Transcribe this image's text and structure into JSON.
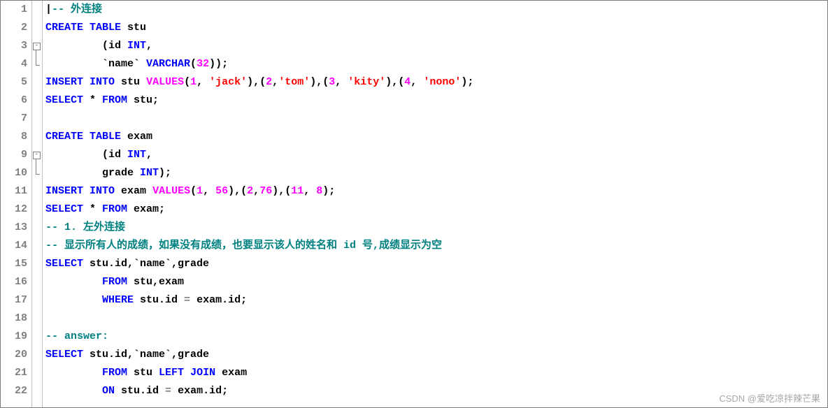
{
  "watermark": "CSDN @爱吃凉拌辣芒果",
  "line_count": 22,
  "fold_regions": [
    {
      "start": 3,
      "end": 4
    },
    {
      "start": 9,
      "end": 10
    }
  ],
  "code_lines": [
    {
      "n": 1,
      "tokens": [
        {
          "t": "|",
          "c": "hl-black"
        },
        {
          "t": "-- 外连接",
          "c": "hl-active"
        }
      ],
      "cursor_before": 0
    },
    {
      "n": 2,
      "tokens": [
        {
          "t": "CREATE",
          "c": "hl-keyword"
        },
        {
          "t": " ",
          "c": ""
        },
        {
          "t": "TABLE",
          "c": "hl-keyword"
        },
        {
          "t": " stu",
          "c": "hl-black"
        }
      ]
    },
    {
      "n": 3,
      "tokens": [
        {
          "t": "         (id ",
          "c": "hl-black"
        },
        {
          "t": "INT",
          "c": "hl-keyword"
        },
        {
          "t": ",",
          "c": "hl-black"
        }
      ]
    },
    {
      "n": 4,
      "tokens": [
        {
          "t": "         `name` ",
          "c": "hl-black"
        },
        {
          "t": "VARCHAR",
          "c": "hl-keyword"
        },
        {
          "t": "(",
          "c": "hl-black"
        },
        {
          "t": "32",
          "c": "hl-func"
        },
        {
          "t": "));",
          "c": "hl-black"
        }
      ]
    },
    {
      "n": 5,
      "tokens": [
        {
          "t": "INSERT",
          "c": "hl-keyword"
        },
        {
          "t": " ",
          "c": ""
        },
        {
          "t": "INTO",
          "c": "hl-keyword"
        },
        {
          "t": " stu ",
          "c": "hl-black"
        },
        {
          "t": "VALUES",
          "c": "hl-func"
        },
        {
          "t": "(",
          "c": "hl-black"
        },
        {
          "t": "1",
          "c": "hl-func"
        },
        {
          "t": ", ",
          "c": "hl-black"
        },
        {
          "t": "'jack'",
          "c": "hl-string"
        },
        {
          "t": "),(",
          "c": "hl-black"
        },
        {
          "t": "2",
          "c": "hl-func"
        },
        {
          "t": ",",
          "c": "hl-black"
        },
        {
          "t": "'tom'",
          "c": "hl-string"
        },
        {
          "t": "),(",
          "c": "hl-black"
        },
        {
          "t": "3",
          "c": "hl-func"
        },
        {
          "t": ", ",
          "c": "hl-black"
        },
        {
          "t": "'kity'",
          "c": "hl-string"
        },
        {
          "t": "),(",
          "c": "hl-black"
        },
        {
          "t": "4",
          "c": "hl-func"
        },
        {
          "t": ", ",
          "c": "hl-black"
        },
        {
          "t": "'nono'",
          "c": "hl-string"
        },
        {
          "t": ");",
          "c": "hl-black"
        }
      ]
    },
    {
      "n": 6,
      "tokens": [
        {
          "t": "SELECT",
          "c": "hl-keyword"
        },
        {
          "t": " * ",
          "c": "hl-black"
        },
        {
          "t": "FROM",
          "c": "hl-keyword"
        },
        {
          "t": " stu;",
          "c": "hl-black"
        }
      ]
    },
    {
      "n": 7,
      "tokens": [
        {
          "t": "",
          "c": ""
        }
      ]
    },
    {
      "n": 8,
      "tokens": [
        {
          "t": "CREATE",
          "c": "hl-keyword"
        },
        {
          "t": " ",
          "c": ""
        },
        {
          "t": "TABLE",
          "c": "hl-keyword"
        },
        {
          "t": " exam",
          "c": "hl-black"
        }
      ]
    },
    {
      "n": 9,
      "tokens": [
        {
          "t": "         (id ",
          "c": "hl-black"
        },
        {
          "t": "INT",
          "c": "hl-keyword"
        },
        {
          "t": ",",
          "c": "hl-black"
        }
      ]
    },
    {
      "n": 10,
      "tokens": [
        {
          "t": "         grade ",
          "c": "hl-black"
        },
        {
          "t": "INT",
          "c": "hl-keyword"
        },
        {
          "t": ");",
          "c": "hl-black"
        }
      ]
    },
    {
      "n": 11,
      "tokens": [
        {
          "t": "INSERT",
          "c": "hl-keyword"
        },
        {
          "t": " ",
          "c": ""
        },
        {
          "t": "INTO",
          "c": "hl-keyword"
        },
        {
          "t": " exam ",
          "c": "hl-black"
        },
        {
          "t": "VALUES",
          "c": "hl-func"
        },
        {
          "t": "(",
          "c": "hl-black"
        },
        {
          "t": "1",
          "c": "hl-func"
        },
        {
          "t": ", ",
          "c": "hl-black"
        },
        {
          "t": "56",
          "c": "hl-func"
        },
        {
          "t": "),(",
          "c": "hl-black"
        },
        {
          "t": "2",
          "c": "hl-func"
        },
        {
          "t": ",",
          "c": "hl-black"
        },
        {
          "t": "76",
          "c": "hl-func"
        },
        {
          "t": "),(",
          "c": "hl-black"
        },
        {
          "t": "11",
          "c": "hl-func"
        },
        {
          "t": ", ",
          "c": "hl-black"
        },
        {
          "t": "8",
          "c": "hl-func"
        },
        {
          "t": ");",
          "c": "hl-black"
        }
      ]
    },
    {
      "n": 12,
      "tokens": [
        {
          "t": "SELECT",
          "c": "hl-keyword"
        },
        {
          "t": " * ",
          "c": "hl-black"
        },
        {
          "t": "FROM",
          "c": "hl-keyword"
        },
        {
          "t": " exam;",
          "c": "hl-black"
        }
      ]
    },
    {
      "n": 13,
      "tokens": [
        {
          "t": "-- 1. 左外连接",
          "c": "hl-comment"
        }
      ]
    },
    {
      "n": 14,
      "tokens": [
        {
          "t": "-- 显示所有人的成绩，如果没有成绩，也要显示该人的姓名和 id 号,成绩显示为空",
          "c": "hl-comment"
        }
      ]
    },
    {
      "n": 15,
      "tokens": [
        {
          "t": "SELECT",
          "c": "hl-keyword"
        },
        {
          "t": " stu.id,`name`,grade",
          "c": "hl-black"
        }
      ]
    },
    {
      "n": 16,
      "tokens": [
        {
          "t": "         ",
          "c": ""
        },
        {
          "t": "FROM",
          "c": "hl-keyword"
        },
        {
          "t": " stu,exam",
          "c": "hl-black"
        }
      ]
    },
    {
      "n": 17,
      "tokens": [
        {
          "t": "         ",
          "c": ""
        },
        {
          "t": "WHERE",
          "c": "hl-keyword"
        },
        {
          "t": " stu.id ",
          "c": "hl-black"
        },
        {
          "t": "=",
          "c": "hl-gray"
        },
        {
          "t": " exam.id;",
          "c": "hl-black"
        }
      ]
    },
    {
      "n": 18,
      "tokens": [
        {
          "t": "",
          "c": ""
        }
      ]
    },
    {
      "n": 19,
      "tokens": [
        {
          "t": "-- answer:",
          "c": "hl-comment"
        }
      ]
    },
    {
      "n": 20,
      "tokens": [
        {
          "t": "SELECT",
          "c": "hl-keyword"
        },
        {
          "t": " stu.id,`name`,grade",
          "c": "hl-black"
        }
      ]
    },
    {
      "n": 21,
      "tokens": [
        {
          "t": "         ",
          "c": ""
        },
        {
          "t": "FROM",
          "c": "hl-keyword"
        },
        {
          "t": " stu ",
          "c": "hl-black"
        },
        {
          "t": "LEFT",
          "c": "hl-keyword"
        },
        {
          "t": " ",
          "c": ""
        },
        {
          "t": "JOIN",
          "c": "hl-keyword"
        },
        {
          "t": " exam",
          "c": "hl-black"
        }
      ]
    },
    {
      "n": 22,
      "tokens": [
        {
          "t": "         ",
          "c": ""
        },
        {
          "t": "ON",
          "c": "hl-keyword"
        },
        {
          "t": " stu.id ",
          "c": "hl-black"
        },
        {
          "t": "=",
          "c": "hl-gray"
        },
        {
          "t": " exam.id;",
          "c": "hl-black"
        }
      ]
    }
  ]
}
